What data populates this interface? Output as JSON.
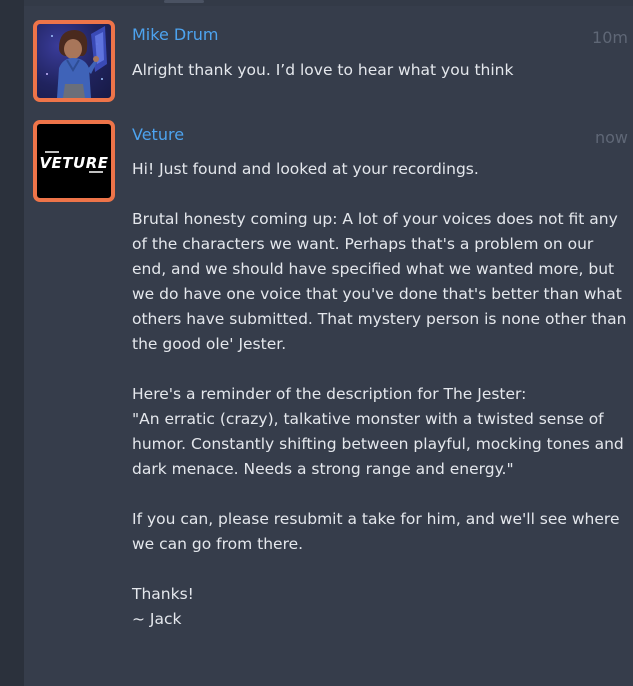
{
  "colors": {
    "background": "#363d4b",
    "rail": "#2b313c",
    "username": "#4da3ef",
    "timestamp": "#5f6776",
    "text": "#e4e7ec",
    "avatar_border": "#ee7449"
  },
  "messages": [
    {
      "username": "Mike Drum",
      "time": "10m",
      "avatar": "user-portrait-avatar",
      "paragraphs": [
        "Alright thank you. I’d love to hear what you think"
      ]
    },
    {
      "username": "Veture",
      "time": "now",
      "avatar": "veture-logo-avatar",
      "avatar_text": "VETURE",
      "paragraphs": [
        "Hi! Just found and looked at your recordings.",
        "Brutal honesty coming up: A lot of your voices does not fit any of the characters we want. Perhaps that's a problem on our end, and we should have specified what we wanted more, but we do have one voice that you've done that's better than what others have submitted. That mystery person is none other than the good ole' Jester.",
        "Here's a reminder of the description for The Jester:",
        "\"An erratic (crazy), talkative monster with a twisted sense of humor. Constantly shifting between playful, mocking tones and dark menace. Needs a strong range and energy.\"",
        "If you can, please resubmit a take for him, and we'll see where we can go from there.",
        "Thanks!",
        "~ Jack"
      ]
    }
  ]
}
